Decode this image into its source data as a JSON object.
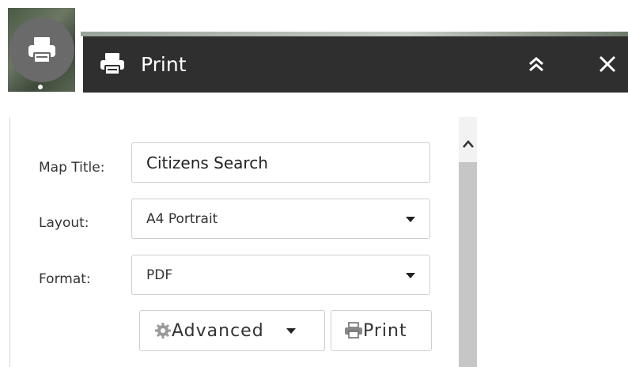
{
  "widget": {
    "icon": "printer-icon"
  },
  "titlebar": {
    "title": "Print",
    "icon": "printer-icon",
    "collapse_icon": "double-chevron-up-icon",
    "close_icon": "close-icon"
  },
  "form": {
    "map_title": {
      "label": "Map Title:",
      "value": "Citizens Search"
    },
    "layout": {
      "label": "Layout:",
      "selected": "A4 Portrait"
    },
    "format": {
      "label": "Format:",
      "selected": "PDF"
    }
  },
  "buttons": {
    "advanced_label": "Advanced",
    "advanced_icon": "gear-icon",
    "print_label": "Print",
    "print_icon": "printer-icon"
  },
  "colors": {
    "titlebar_bg": "#2f2f2f",
    "widget_bg": "#6a6a6a",
    "scrollbar_thumb": "#c6c6c6"
  }
}
